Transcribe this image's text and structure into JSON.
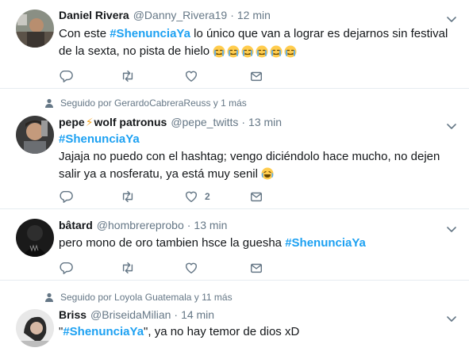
{
  "tweets": [
    {
      "name": "Daniel Rivera",
      "handle": "@Danny_Rivera19",
      "time": "12 min",
      "text_before": "Con este ",
      "hashtag": "#ShenunciaYa",
      "text_after": " lo único que van a lograr es dejarnos sin festival de la sexta, no pista de hielo",
      "emoji_count": 6,
      "likes": ""
    },
    {
      "social_context": "Seguido por GerardoCabreraReuss y 1 más",
      "name_part1": "pepe",
      "name_bolt": "⚡",
      "name_part2": "wolf patronus",
      "handle": "@pepe_twitts",
      "time": "13 min",
      "hashtag_line": "#ShenunciaYa",
      "text": "Jajaja no puedo con el hashtag; vengo diciéndolo hace mucho, no dejen salir ya a nosferatu, ya está muy senil",
      "likes": "2"
    },
    {
      "name": "bâtard",
      "handle": "@hombrereprobo",
      "time": "13 min",
      "text": "pero mono de oro tambien hsce la guesha ",
      "hashtag": "#ShenunciaYa",
      "likes": ""
    },
    {
      "social_context": "Seguido por Loyola Guatemala y 11 más",
      "name": "Briss",
      "handle": "@BriseidaMilian",
      "time": "14 min",
      "quote_open": "\"",
      "hashtag": "#ShenunciaYa",
      "text_after": "\", ya no hay temor de dios xD"
    }
  ],
  "separator": "·",
  "colors": {
    "hashtag": "#1da1f2",
    "secondary": "#657786",
    "border": "#e6ecf0"
  },
  "icons": [
    "reply-icon",
    "retweet-icon",
    "like-icon",
    "message-icon",
    "chevron-down-icon",
    "person-icon"
  ]
}
